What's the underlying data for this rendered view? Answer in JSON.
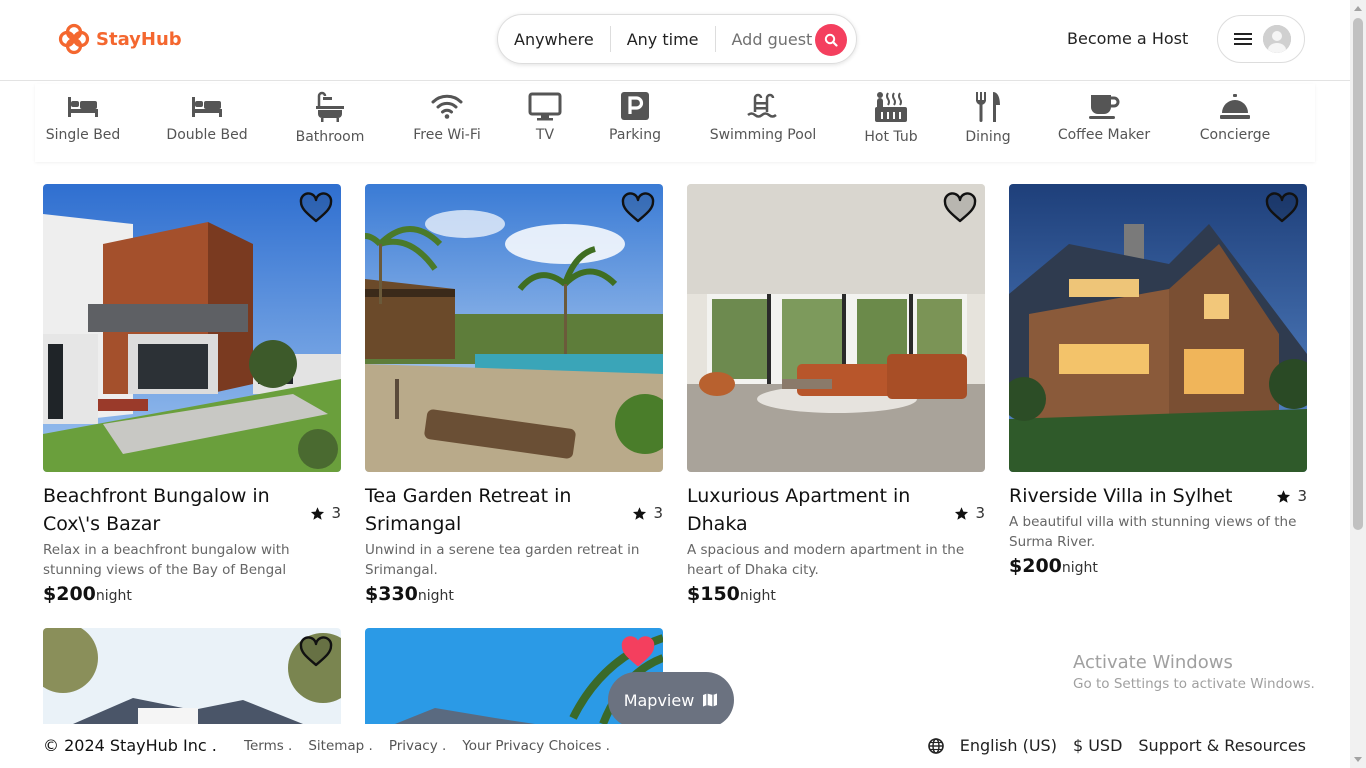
{
  "brand": {
    "name": "StayHub",
    "color": "#f4672f"
  },
  "search": {
    "location": "Anywhere",
    "time": "Any time",
    "guests": "Add guest",
    "button_color": "#f43f5e"
  },
  "header": {
    "become_host": "Become a Host",
    "menu_icon": "hamburger-icon",
    "avatar_icon": "user-avatar-icon"
  },
  "categories": [
    {
      "label": "Single Bed",
      "icon": "single-bed-icon"
    },
    {
      "label": "Double Bed",
      "icon": "double-bed-icon"
    },
    {
      "label": "Bathroom",
      "icon": "bathtub-icon"
    },
    {
      "label": "Free Wi-Fi",
      "icon": "wifi-icon"
    },
    {
      "label": "TV",
      "icon": "tv-icon"
    },
    {
      "label": "Parking",
      "icon": "parking-icon"
    },
    {
      "label": "Swimming Pool",
      "icon": "pool-icon"
    },
    {
      "label": "Hot Tub",
      "icon": "hot-tub-icon"
    },
    {
      "label": "Dining",
      "icon": "dining-icon"
    },
    {
      "label": "Coffee Maker",
      "icon": "coffee-icon"
    },
    {
      "label": "Concierge",
      "icon": "concierge-bell-icon"
    }
  ],
  "listings": [
    {
      "title": "Beachfront Bungalow in Cox\\'s Bazar",
      "rating": "3",
      "description": "Relax in a beachfront bungalow with stunning views of the Bay of Bengal",
      "price": "$200",
      "unit": "night",
      "favorited": false
    },
    {
      "title": "Tea Garden Retreat in Srimangal",
      "rating": "3",
      "description": "Unwind in a serene tea garden retreat in Srimangal.",
      "price": "$330",
      "unit": "night",
      "favorited": false
    },
    {
      "title": "Luxurious Apartment in Dhaka",
      "rating": "3",
      "description": "A spacious and modern apartment in the heart of Dhaka city.",
      "price": "$150",
      "unit": "night",
      "favorited": false
    },
    {
      "title": "Riverside Villa in Sylhet",
      "rating": "3",
      "description": "A beautiful villa with stunning views of the Surma River.",
      "price": "$200",
      "unit": "night",
      "favorited": false
    },
    {
      "favorited": false
    },
    {
      "favorited": true
    }
  ],
  "mapview": {
    "label": "Mapview"
  },
  "watermark": {
    "line1": "Activate Windows",
    "line2": "Go to Settings to activate Windows."
  },
  "footer": {
    "copyright": "© 2024 StayHub Inc .",
    "links": [
      "Terms .",
      "Sitemap .",
      "Privacy .",
      "Your Privacy Choices ."
    ],
    "language": "English (US)",
    "currency": "$ USD",
    "support": "Support & Resources"
  },
  "colors": {
    "heart_active": "#f43f5e",
    "mapview_bg": "#6b7280"
  }
}
